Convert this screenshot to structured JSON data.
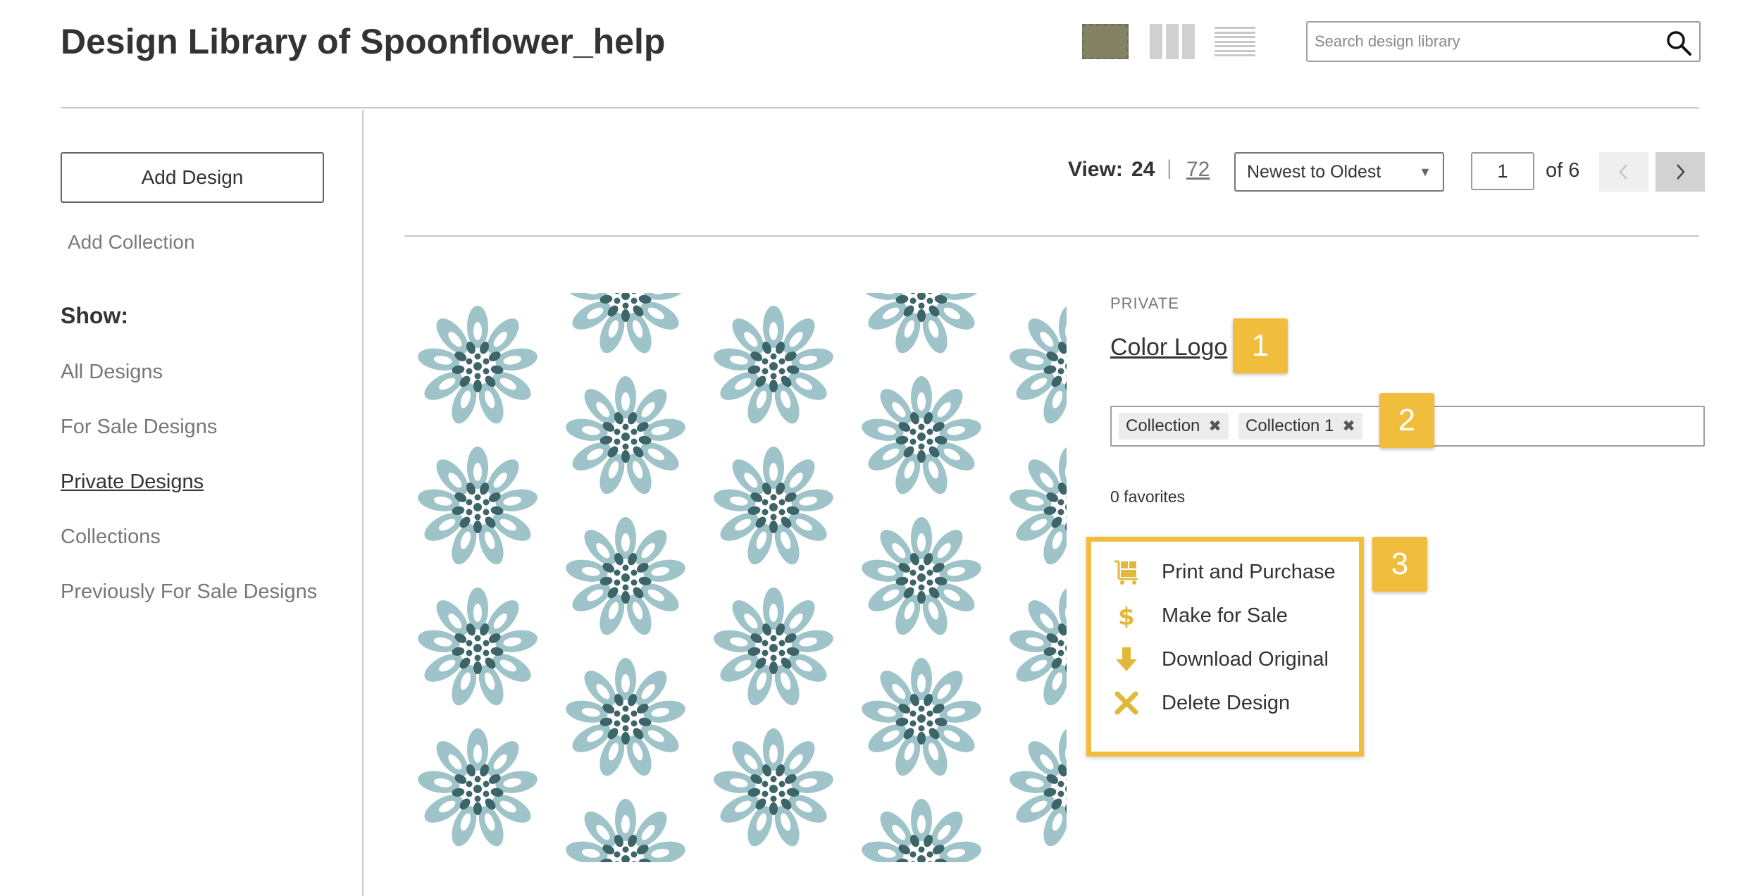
{
  "header": {
    "title": "Design Library of Spoonflower_help",
    "search_placeholder": "Search design library"
  },
  "sidebar": {
    "add_design_label": "Add Design",
    "add_collection_label": "Add Collection",
    "show_label": "Show:",
    "filters": [
      {
        "label": "All Designs",
        "active": false
      },
      {
        "label": "For Sale Designs",
        "active": false
      },
      {
        "label": "Private Designs",
        "active": true
      },
      {
        "label": "Collections",
        "active": false
      },
      {
        "label": "Previously For Sale Designs",
        "active": false
      }
    ]
  },
  "toolbar": {
    "view_label": "View:",
    "view_24": "24",
    "view_separator": "|",
    "view_72": "72",
    "sort_value": "Newest to Oldest",
    "page_value": "1",
    "page_of": "of 6"
  },
  "design": {
    "visibility": "PRIVATE",
    "title": "Color Logo",
    "collections": [
      "Collection",
      "Collection 1"
    ],
    "favorites": "0 favorites",
    "actions": [
      {
        "label": "Print and Purchase",
        "icon": "cart-icon"
      },
      {
        "label": "Make for Sale",
        "icon": "dollar-icon"
      },
      {
        "label": "Download Original",
        "icon": "download-arrow-icon"
      },
      {
        "label": "Delete Design",
        "icon": "delete-x-icon"
      }
    ]
  },
  "callouts": [
    "1",
    "2",
    "3"
  ],
  "colors": {
    "accent_yellow": "#f1bd3c",
    "icon_gold": "#e2b83a",
    "petal_light": "#9ec3c8",
    "petal_dark": "#3d6468",
    "grid_view_active": "#848264"
  }
}
